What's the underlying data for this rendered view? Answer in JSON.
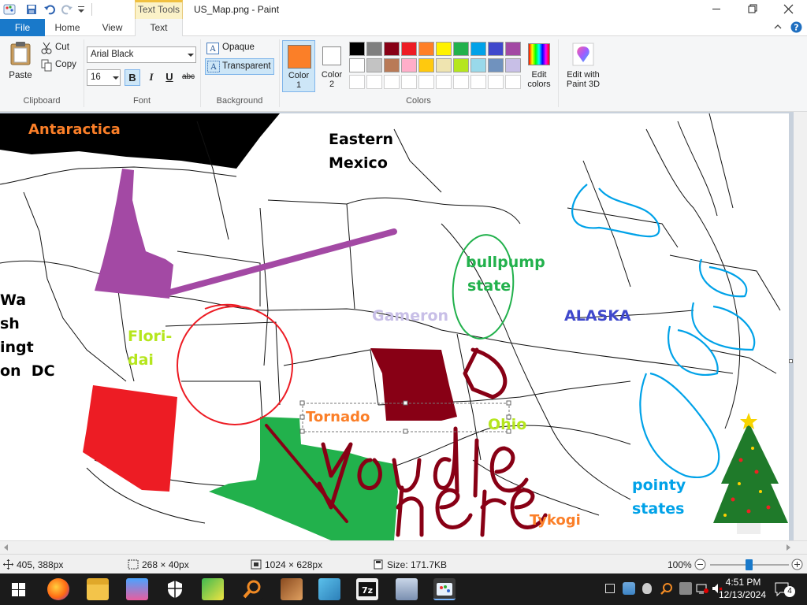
{
  "window": {
    "title": "US_Map.png - Paint",
    "context_tab": "Text Tools"
  },
  "tabs": [
    {
      "label": "File"
    },
    {
      "label": "Home"
    },
    {
      "label": "View"
    },
    {
      "label": "Text"
    }
  ],
  "ribbon": {
    "clipboard": {
      "paste": "Paste",
      "cut": "Cut",
      "copy": "Copy",
      "group": "Clipboard"
    },
    "font": {
      "family": "Arial Black",
      "size": "16",
      "bold": "B",
      "italic": "I",
      "underline": "U",
      "strike": "abc",
      "group": "Font"
    },
    "background": {
      "opaque": "Opaque",
      "transparent": "Transparent",
      "group": "Background"
    },
    "colors": {
      "color1_label": "Color",
      "color1_num": "1",
      "color2_label": "Color",
      "color2_num": "2",
      "color1": "#fb7f28",
      "color2": "#ffffff",
      "edit": "Edit colors",
      "edit_line1": "Edit",
      "edit_line2": "colors",
      "paint3d_line1": "Edit with",
      "paint3d_line2": "Paint 3D",
      "group": "Colors",
      "palette_row1": [
        "#000000",
        "#7f7f7f",
        "#880015",
        "#ed1c24",
        "#ff7f27",
        "#fff200",
        "#22b14c",
        "#00a2e8",
        "#3f48cc",
        "#a349a4"
      ],
      "palette_row2": [
        "#ffffff",
        "#c3c3c3",
        "#b97a57",
        "#ffaec9",
        "#ffc90e",
        "#efe4b0",
        "#b5e61d",
        "#99d9ea",
        "#7092be",
        "#c8bfe7"
      ]
    }
  },
  "map_labels": {
    "antaractica": "Antaractica",
    "eastern": "Eastern",
    "mexico": "Mexico",
    "wa": "Wa",
    "sh": "sh",
    "ingt": "ingt",
    "on_dc": "on  DC",
    "flori": "Flori-",
    "dai": "dai",
    "gameron": "Gameron",
    "bullpump": "bullpump",
    "state": "state",
    "alaska": "ALASKA",
    "tornado": "Tornado",
    "ohio": "Ohio",
    "pointy": "pointy",
    "states": "states",
    "tykogi": "Tykogi"
  },
  "status": {
    "cursor": "405, 388px",
    "selection": "268 × 40px",
    "canvas_size": "1024 × 628px",
    "file_size": "Size: 171.7KB",
    "zoom": "100%"
  },
  "taskbar": {
    "time": "4:51 PM",
    "date": "12/13/2024",
    "notifications": "4"
  }
}
